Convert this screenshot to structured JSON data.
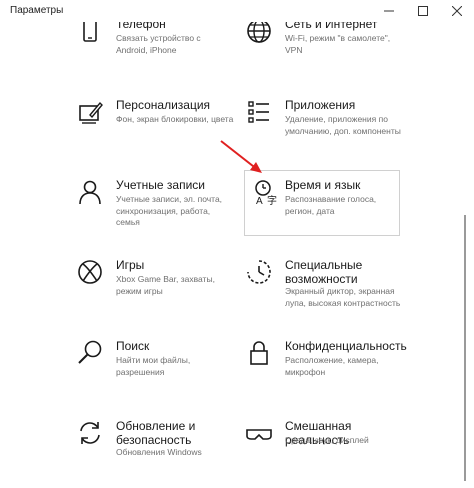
{
  "window": {
    "title": "Параметры",
    "controls": {
      "minimize_icon": "minimize-icon",
      "maximize_icon": "maximize-icon",
      "close_icon": "close-icon"
    }
  },
  "tiles": [
    {
      "id": "phone",
      "icon": "phone-icon",
      "name": "Телефон",
      "desc": "Связать устройство с Android, iPhone"
    },
    {
      "id": "network",
      "icon": "globe-icon",
      "name": "Сеть и Интернет",
      "desc": "Wi-Fi, режим \"в самолете\", VPN"
    },
    {
      "id": "personalization",
      "icon": "personalization-icon",
      "name": "Персонализация",
      "desc": "Фон, экран блокировки, цвета"
    },
    {
      "id": "apps",
      "icon": "apps-list-icon",
      "name": "Приложения",
      "desc": "Удаление, приложения по умолчанию, доп. компоненты"
    },
    {
      "id": "accounts",
      "icon": "person-icon",
      "name": "Учетные записи",
      "desc": "Учетные записи, эл. почта, синхронизация, работа, семья"
    },
    {
      "id": "time_language",
      "icon": "time-language-icon",
      "name": "Время и язык",
      "desc": "Распознавание голоса, регион, дата",
      "selected": true
    },
    {
      "id": "gaming",
      "icon": "xbox-icon",
      "name": "Игры",
      "desc": "Xbox Game Bar, захваты, режим игры"
    },
    {
      "id": "ease_of_access",
      "icon": "ease-of-access-icon",
      "name": "Специальные возможности",
      "desc": "Экранный диктор, экранная лупа, высокая контрастность"
    },
    {
      "id": "search",
      "icon": "search-icon",
      "name": "Поиск",
      "desc": "Найти мои файлы, разрешения"
    },
    {
      "id": "privacy",
      "icon": "lock-icon",
      "name": "Конфиденциальность",
      "desc": "Расположение, камера, микрофон"
    },
    {
      "id": "update",
      "icon": "update-icon",
      "name": "Обновление и безопасность",
      "desc": "Обновления Windows"
    },
    {
      "id": "mixed_reality",
      "icon": "headset-icon",
      "name": "Смешанная реальность",
      "desc": "Среда, звук, дисплей"
    }
  ],
  "annotation": {
    "arrow_color": "#e02020"
  },
  "colors": {
    "accent_text": "#1a1a1a",
    "secondary_text": "#707070",
    "selection_border": "#d0d0d0"
  }
}
